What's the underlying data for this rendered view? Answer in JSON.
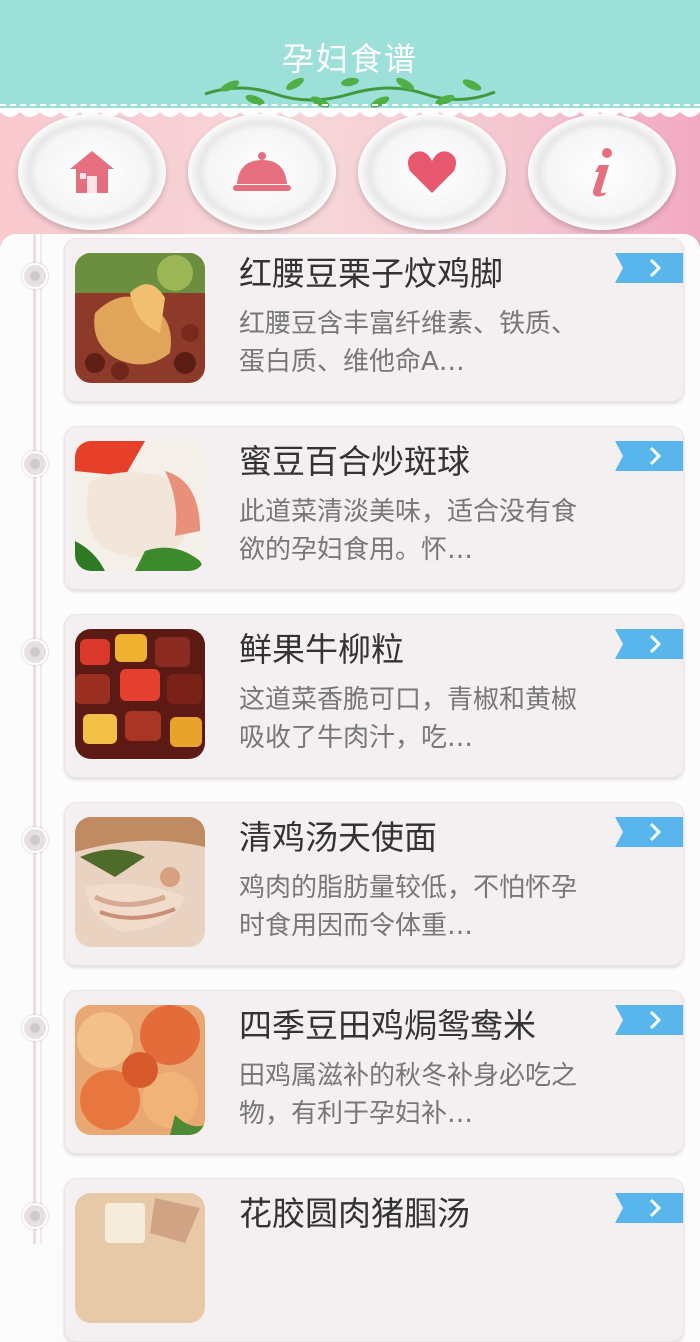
{
  "header": {
    "title": "孕妇食谱"
  },
  "nav": {
    "items": [
      {
        "icon": "home-icon"
      },
      {
        "icon": "dish-cloche-icon"
      },
      {
        "icon": "heart-icon"
      },
      {
        "icon": "info-icon"
      }
    ]
  },
  "recipes": [
    {
      "title": "红腰豆栗子炆鸡脚",
      "desc": "红腰豆含丰富纤维素、铁质、蛋白质、维他命A…"
    },
    {
      "title": "蜜豆百合炒斑球",
      "desc": "此道菜清淡美味，适合没有食欲的孕妇食用。怀…"
    },
    {
      "title": "鲜果牛柳粒",
      "desc": "这道菜香脆可口，青椒和黄椒吸收了牛肉汁，吃…"
    },
    {
      "title": "清鸡汤天使面",
      "desc": "鸡肉的脂肪量较低，不怕怀孕时食用因而令体重…"
    },
    {
      "title": "四季豆田鸡焗鸳鸯米",
      "desc": "田鸡属滋补的秋冬补身必吃之物，有利于孕妇补…"
    },
    {
      "title": "花胶圆肉猪腘汤",
      "desc": ""
    }
  ]
}
